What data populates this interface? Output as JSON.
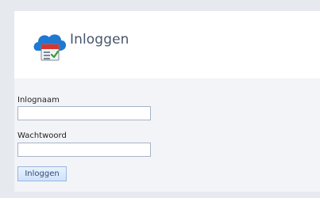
{
  "header": {
    "title": "Inloggen",
    "logo_icon": "cloud-calendar-icon"
  },
  "form": {
    "username_label": "Inlognaam",
    "username_value": "",
    "password_label": "Wachtwoord",
    "password_value": "",
    "submit_label": "Inloggen"
  },
  "colors": {
    "page_bg": "#e6e9ee",
    "header_bg": "#ffffff",
    "form_bg": "#f2f4f7",
    "title_text": "#47566b",
    "field_border": "#a7b4c7",
    "button_bg": "#cfe2fb",
    "button_border": "#9ab7df",
    "cloud_blue": "#1f78d1",
    "calendar_red": "#d9362b",
    "check_green": "#3a9a2f"
  }
}
